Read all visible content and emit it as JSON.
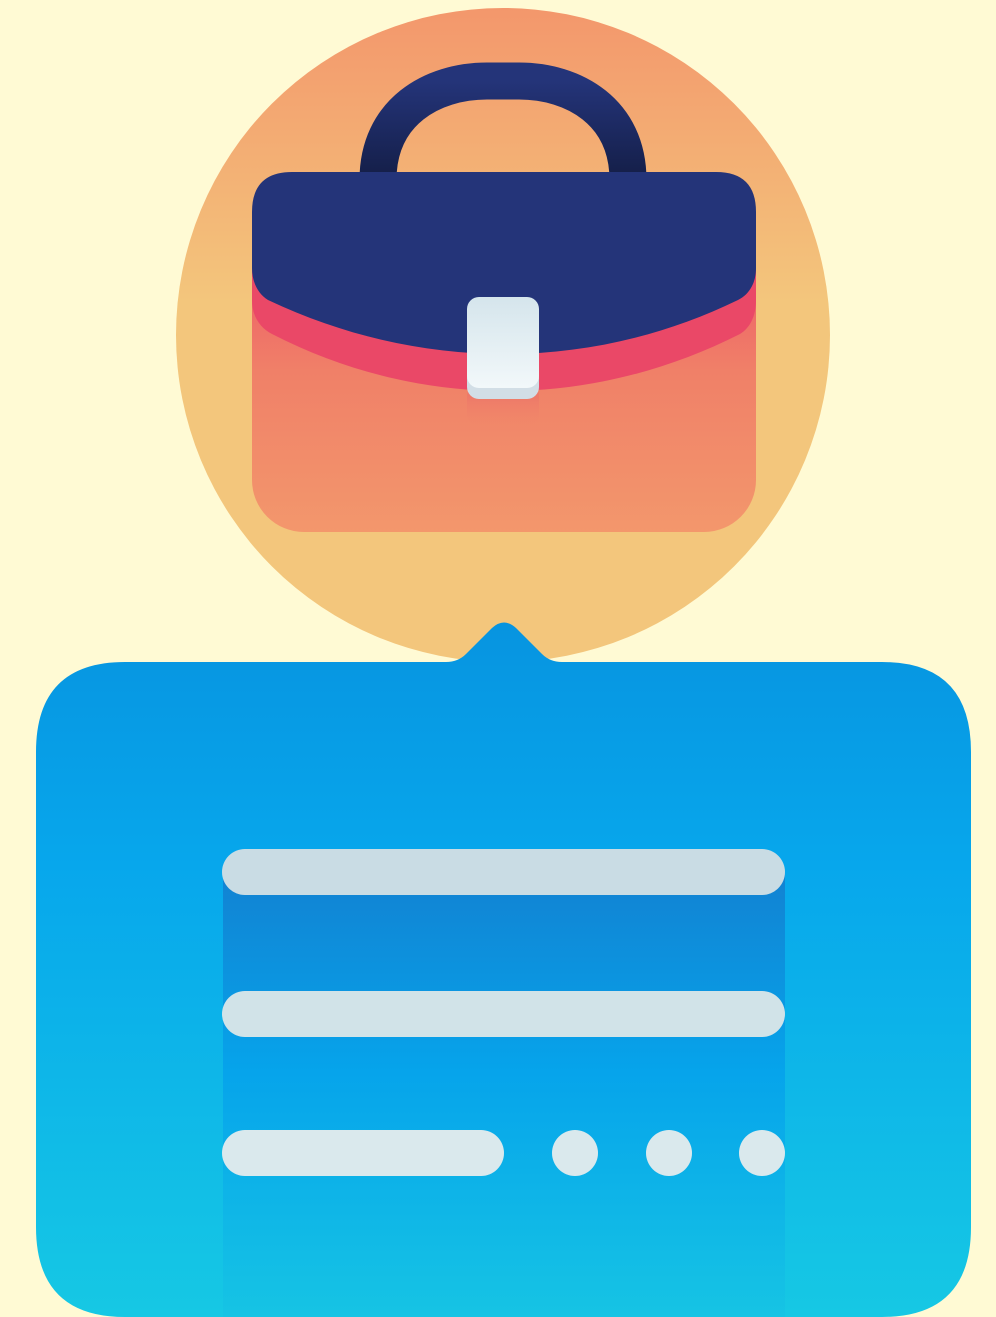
{
  "illustration": {
    "icons": [
      "briefcase-icon",
      "chat-bubble-icon",
      "text-lines-icon",
      "ellipsis-icon"
    ],
    "colors": {
      "background": "#FFFAD4",
      "circle_top": "#F3976C",
      "circle_bottom": "#F3C67C",
      "briefcase_flap": "#243479",
      "briefcase_handle": "#1C2A5E",
      "briefcase_body_top": "#EC4B67",
      "briefcase_body_bottom": "#F3976C",
      "clasp": "#E4EFF3",
      "bubble_top": "#0794E0",
      "bubble_mid": "#07A7EC",
      "bubble_bottom": "#16C8E4",
      "text_lines": "#D6E6EA"
    }
  }
}
